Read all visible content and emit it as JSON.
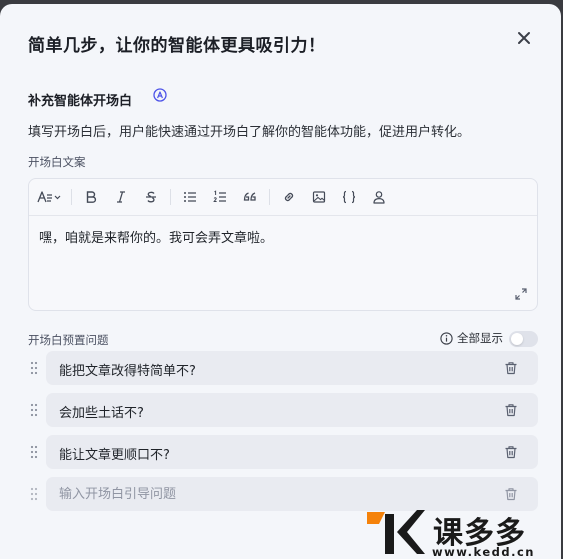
{
  "dialog": {
    "title": "简单几步，让你的智能体更具吸引力！",
    "section_title": "补充智能体开场白",
    "description": "填写开场白后，用户能快速通过开场白了解你的智能体功能，促进用户转化。",
    "copy_label": "开场白文案",
    "editor": {
      "toolbar": [
        "text-style-icon",
        "bold-icon",
        "italic-icon",
        "strikethrough-icon",
        "bullet-list-icon",
        "numbered-list-icon",
        "quote-icon",
        "link-icon",
        "image-icon",
        "code-braces-icon",
        "user-mention-icon"
      ],
      "content": "嘿，咱就是来帮你的。我可会弄文章啦。"
    },
    "questions_label": "开场白预置问题",
    "show_all_label": "全部显示",
    "show_all_enabled": false,
    "questions": [
      "能把文章改得特简单不?",
      "会加些土话不?",
      "能让文章更顺口不?"
    ],
    "new_question_placeholder": "输入开场白引导问题"
  },
  "watermark": {
    "brand": "课多多",
    "url": "www.kedd.cn"
  },
  "colors": {
    "dialog_bg": "#f4f6fa",
    "field_bg": "#e9ebf1",
    "accent": "#4d53e8",
    "watermark_orange": "#f5820a"
  }
}
